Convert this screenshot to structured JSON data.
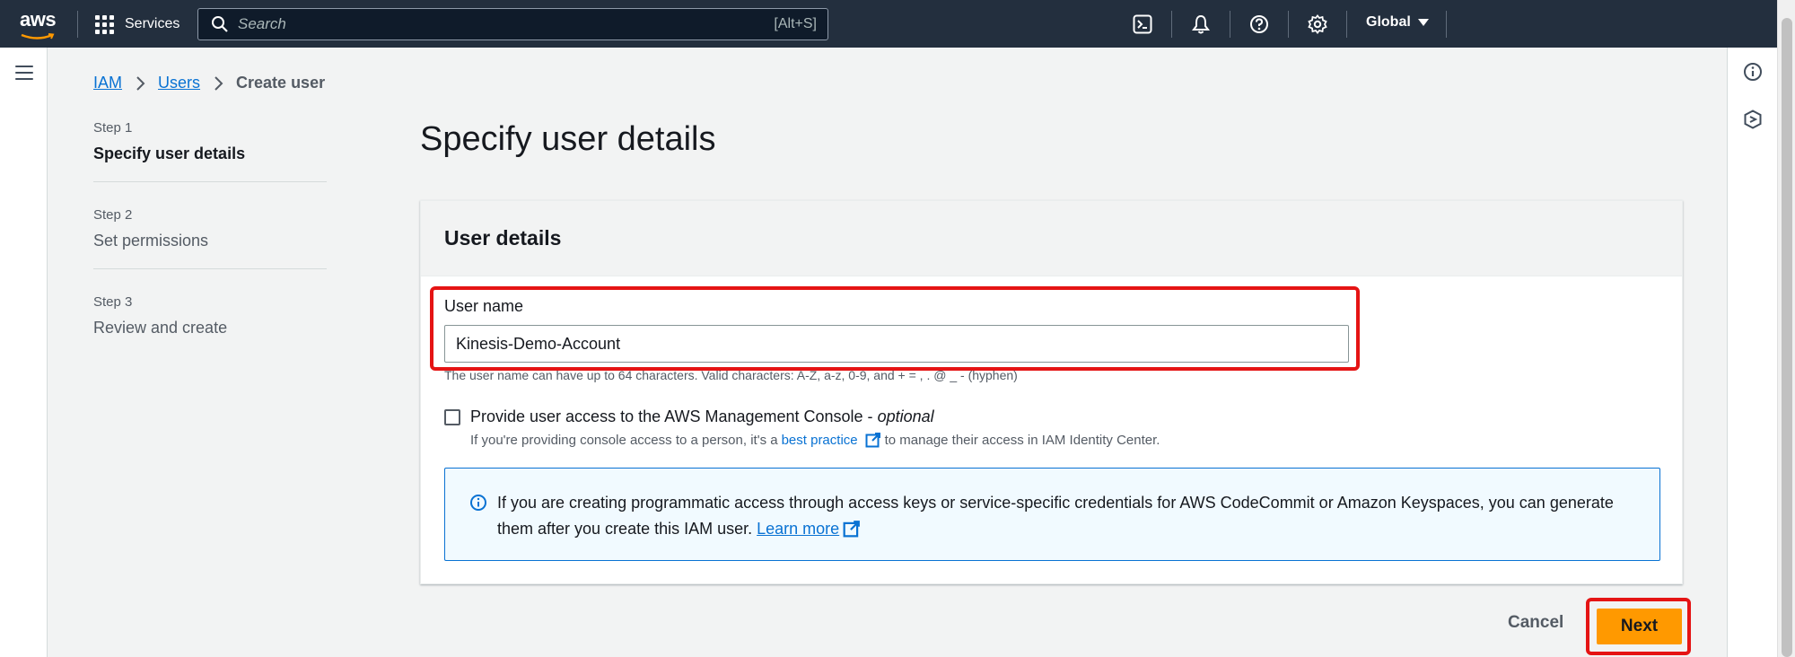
{
  "nav": {
    "logo_text": "aws",
    "services_label": "Services",
    "search_placeholder": "Search",
    "search_shortcut": "[Alt+S]",
    "region_label": "Global"
  },
  "breadcrumb": {
    "items": [
      "IAM",
      "Users"
    ],
    "current": "Create user"
  },
  "steps": [
    {
      "num": "Step 1",
      "title": "Specify user details"
    },
    {
      "num": "Step 2",
      "title": "Set permissions"
    },
    {
      "num": "Step 3",
      "title": "Review and create"
    }
  ],
  "page": {
    "title": "Specify user details"
  },
  "panel": {
    "header": "User details",
    "field_label": "User name",
    "field_value": "Kinesis-Demo-Account",
    "field_hint": "The user name can have up to 64 characters. Valid characters: A-Z, a-z, 0-9, and + = , . @ _ - (hyphen)",
    "checkbox_label": "Provide user access to the AWS Management Console - ",
    "checkbox_optional": "optional",
    "checkbox_desc_before": "If you're providing console access to a person, it's a",
    "checkbox_desc_link": "best practice",
    "checkbox_desc_after": "to manage their access in IAM Identity Center.",
    "info_text": "If you are creating programmatic access through access keys or service-specific credentials for AWS CodeCommit or Amazon Keyspaces, you can generate them after you create this IAM user.",
    "info_link": "Learn more"
  },
  "actions": {
    "cancel": "Cancel",
    "next": "Next"
  },
  "colors": {
    "nav_bg": "#232f3e",
    "primary_button": "#ff9900",
    "link": "#0972d3",
    "highlight": "#e51414"
  }
}
